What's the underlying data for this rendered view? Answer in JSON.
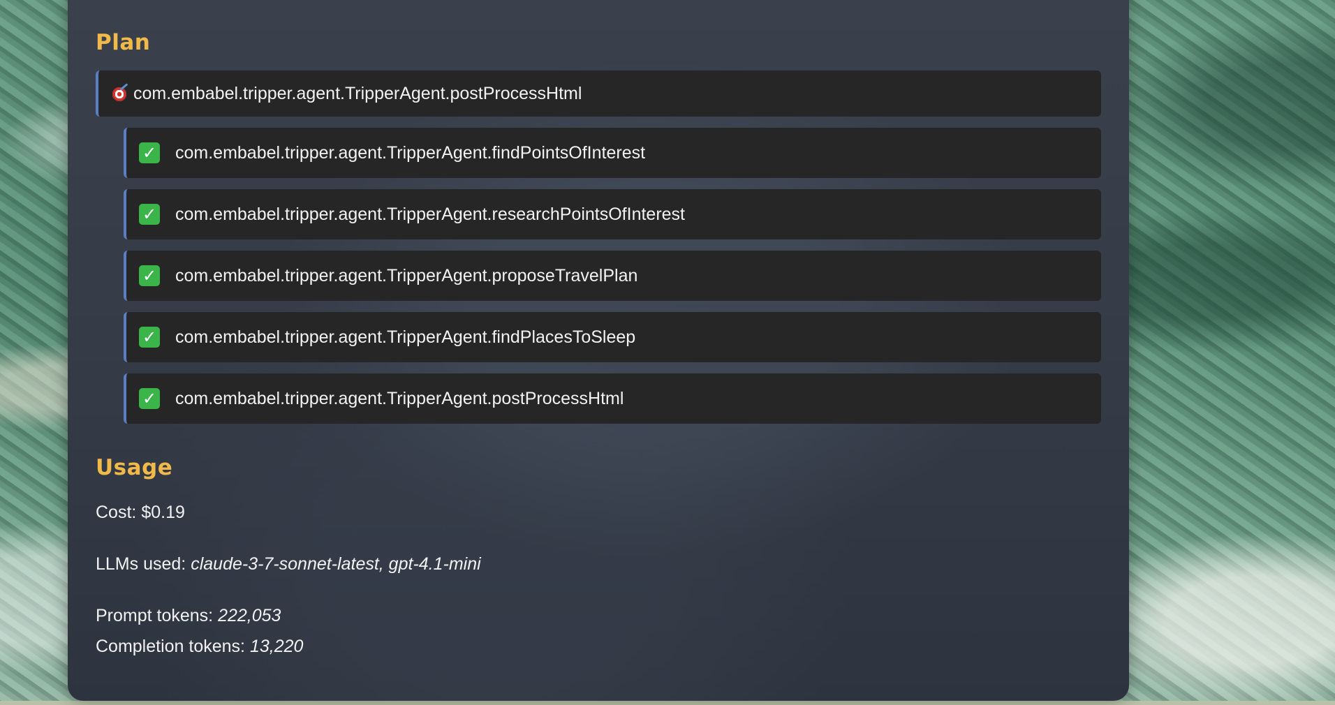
{
  "plan": {
    "title": "Plan",
    "goal": {
      "icon": "target-icon",
      "label": "com.embabel.tripper.agent.TripperAgent.postProcessHtml"
    },
    "steps": [
      {
        "icon": "check-icon",
        "label": "com.embabel.tripper.agent.TripperAgent.findPointsOfInterest"
      },
      {
        "icon": "check-icon",
        "label": "com.embabel.tripper.agent.TripperAgent.researchPointsOfInterest"
      },
      {
        "icon": "check-icon",
        "label": "com.embabel.tripper.agent.TripperAgent.proposeTravelPlan"
      },
      {
        "icon": "check-icon",
        "label": "com.embabel.tripper.agent.TripperAgent.findPlacesToSleep"
      },
      {
        "icon": "check-icon",
        "label": "com.embabel.tripper.agent.TripperAgent.postProcessHtml"
      }
    ]
  },
  "usage": {
    "title": "Usage",
    "cost_label": "Cost:",
    "cost_value": "$0.19",
    "llms_label": "LLMs used:",
    "llms_value": "claude-3-7-sonnet-latest, gpt-4.1-mini",
    "prompt_tokens_label": "Prompt tokens:",
    "prompt_tokens_value": "222,053",
    "completion_tokens_label": "Completion tokens:",
    "completion_tokens_value": "13,220"
  },
  "colors": {
    "heading": "#f0b94a",
    "accent_border": "#5a7fc2",
    "row_background": "#262626",
    "check": "#3bb54a"
  }
}
